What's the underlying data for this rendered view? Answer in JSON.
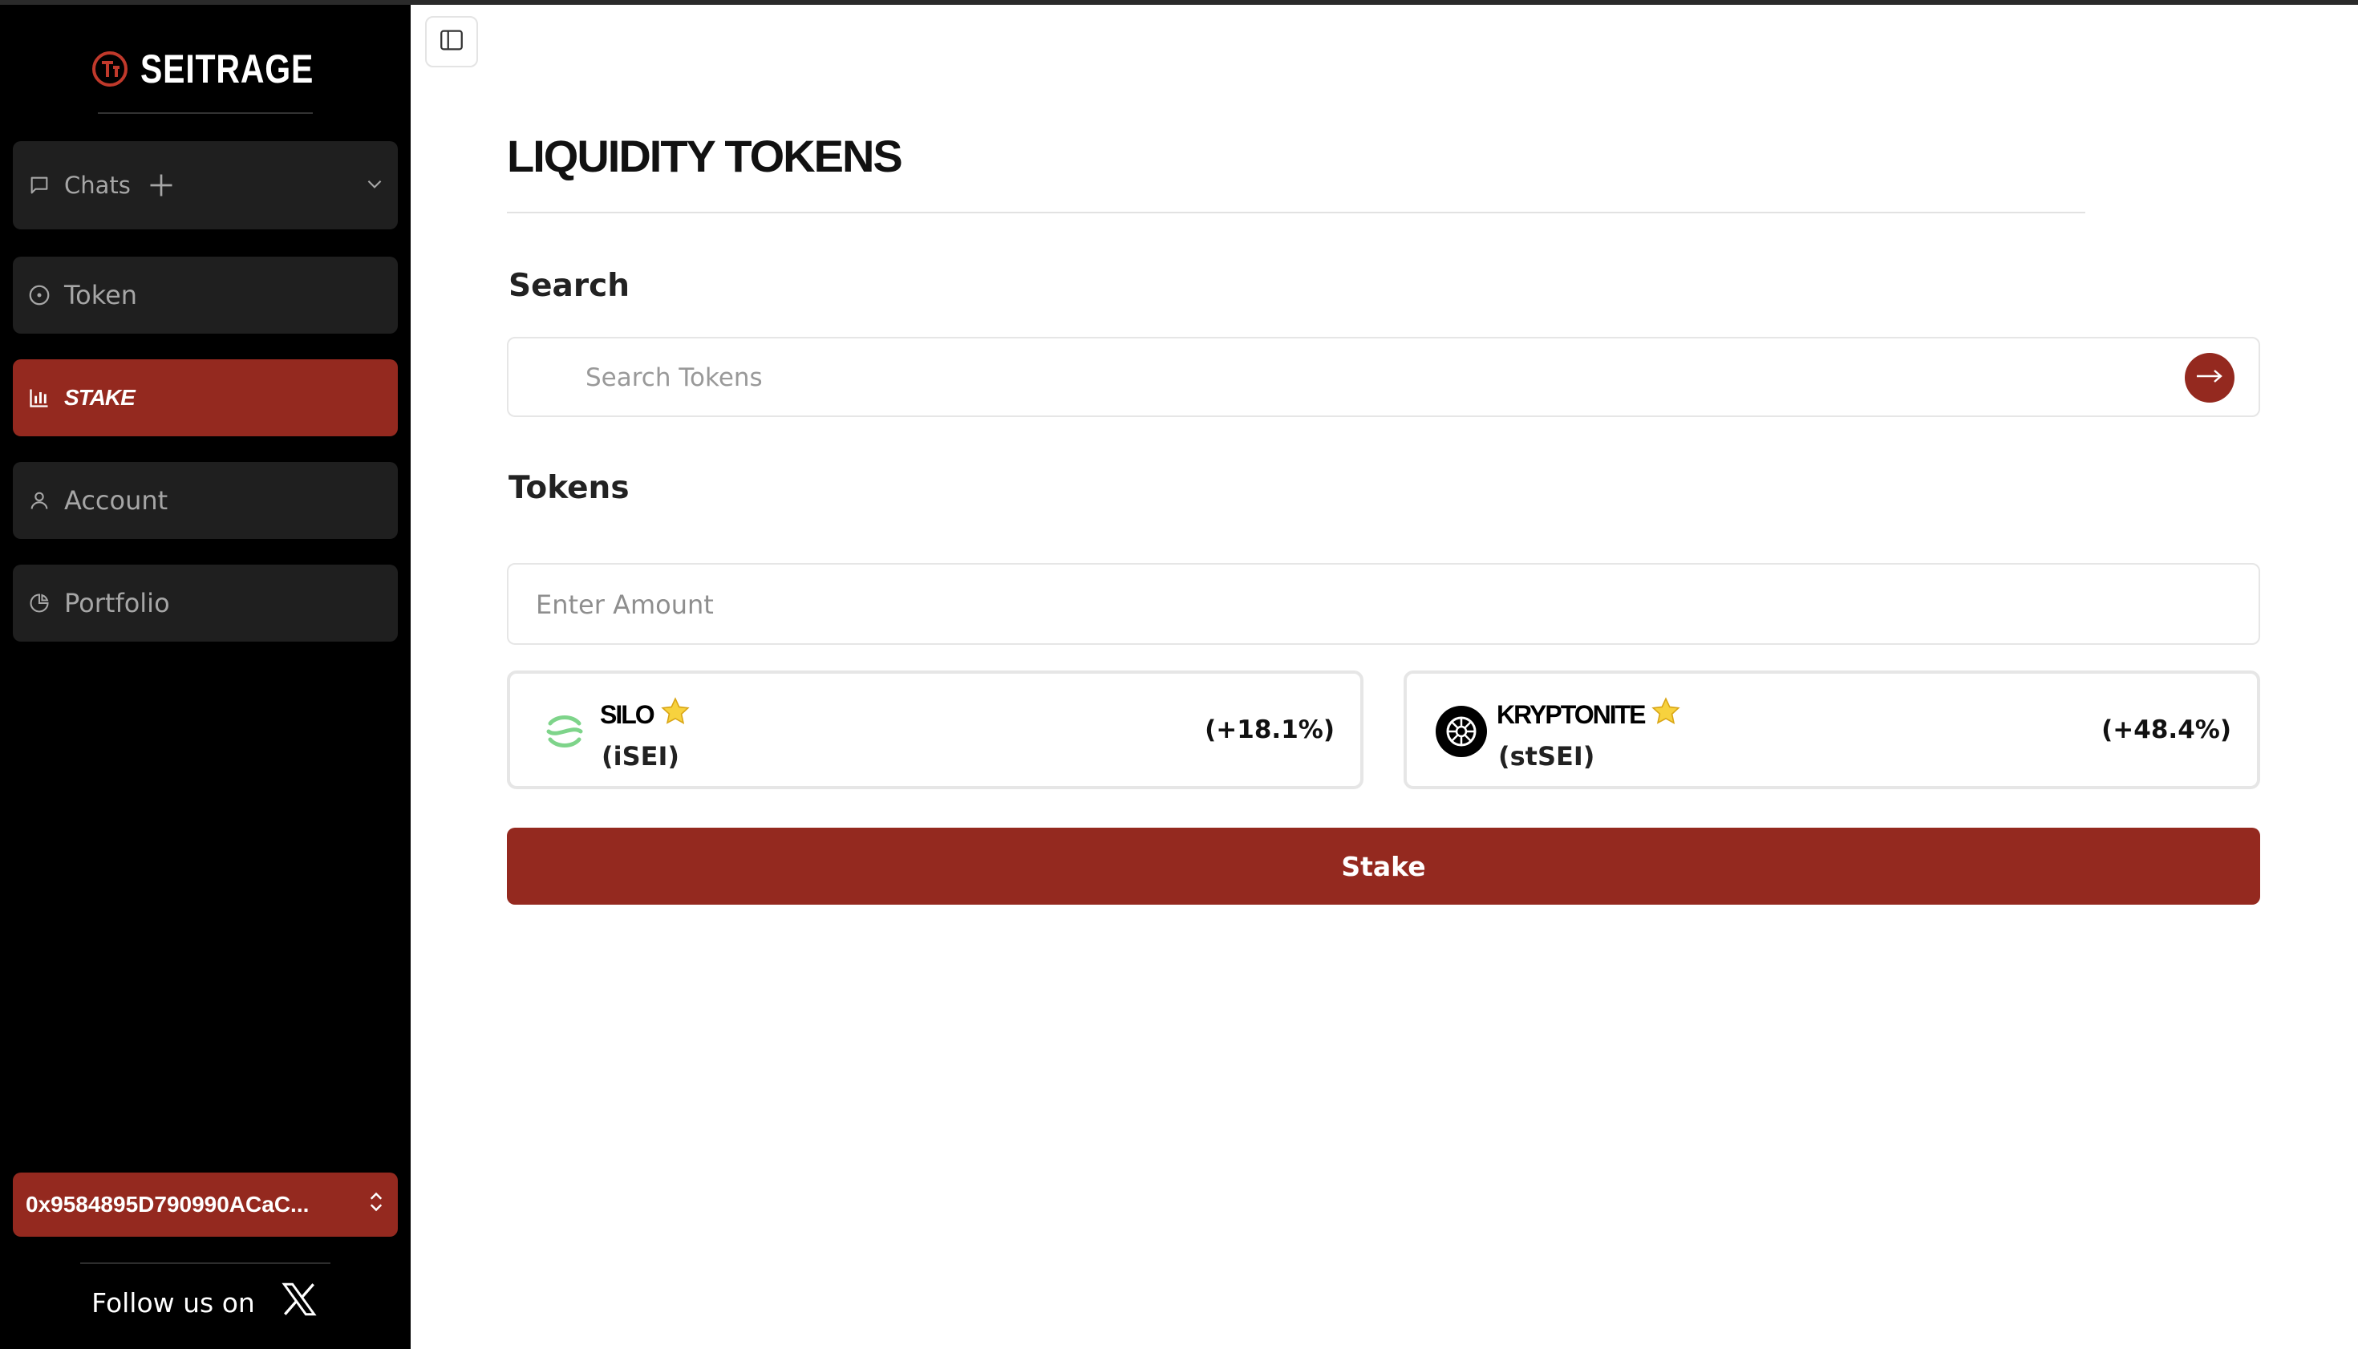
{
  "brand": {
    "name": "SEITRAGE"
  },
  "sidebar": {
    "chats_label": "Chats",
    "items": [
      {
        "label": "Token",
        "icon": "circle-dot-icon"
      },
      {
        "label": "STAKE",
        "icon": "chart-icon",
        "active": true
      },
      {
        "label": "Account",
        "icon": "user-icon"
      },
      {
        "label": "Portfolio",
        "icon": "pie-chart-icon"
      }
    ],
    "wallet_address": "0x9584895D790990ACaC...",
    "follow_text": "Follow us on"
  },
  "main": {
    "title": "LIQUIDITY TOKENS",
    "search_label": "Search",
    "search_placeholder": "Search Tokens",
    "tokens_label": "Tokens",
    "amount_placeholder": "Enter Amount",
    "tokens": [
      {
        "name": "SILO",
        "symbol": "(iSEI)",
        "change": "(+18.1%)"
      },
      {
        "name": "KRYPTONITE",
        "symbol": "(stSEI)",
        "change": "(+48.4%)"
      }
    ],
    "stake_label": "Stake"
  },
  "colors": {
    "accent": "#94291f",
    "sidebar_bg": "#000000",
    "nav_bg": "#1f1f1f",
    "silo_green": "#7ed48a"
  }
}
